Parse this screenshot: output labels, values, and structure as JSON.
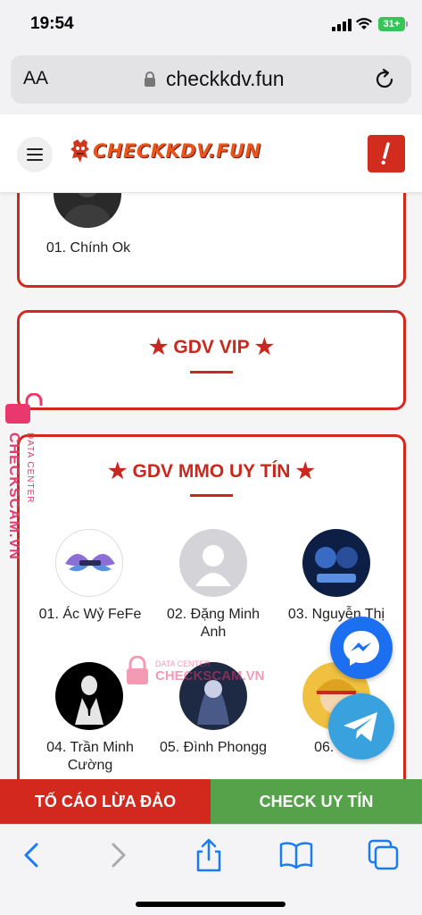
{
  "status_bar": {
    "time": "19:54",
    "battery": "31+"
  },
  "browser": {
    "text_size_label": "AA",
    "url": "checkkdv.fun"
  },
  "header": {
    "logo_text": "CHECKKDV.FUN"
  },
  "sections": {
    "top_card": {
      "member_name": "01. Chính Ok"
    },
    "vip": {
      "title": "GDV VIP"
    },
    "mmo": {
      "title": "GDV MMO UY TÍN",
      "members": [
        {
          "name": "01. Ác Wỷ FeFe"
        },
        {
          "name": "02. Đặng Minh Anh"
        },
        {
          "name": "03. Nguyễn Thị"
        },
        {
          "name": "04. Trần Minh Cường"
        },
        {
          "name": "05. Đình Phongg"
        },
        {
          "name": "06. Trầ"
        }
      ]
    }
  },
  "watermark": {
    "brand": "CHECKSCAM.VN",
    "subtitle": "DATA CENTER"
  },
  "actions": {
    "report_label": "TỐ CÁO LỪA ĐẢO",
    "check_label": "CHECK UY TÍN"
  },
  "colors": {
    "accent_red": "#d2281e",
    "green": "#56a24a",
    "messenger": "#1d6ff2",
    "telegram": "#39a1dd",
    "watermark_pink": "#e8386e"
  }
}
